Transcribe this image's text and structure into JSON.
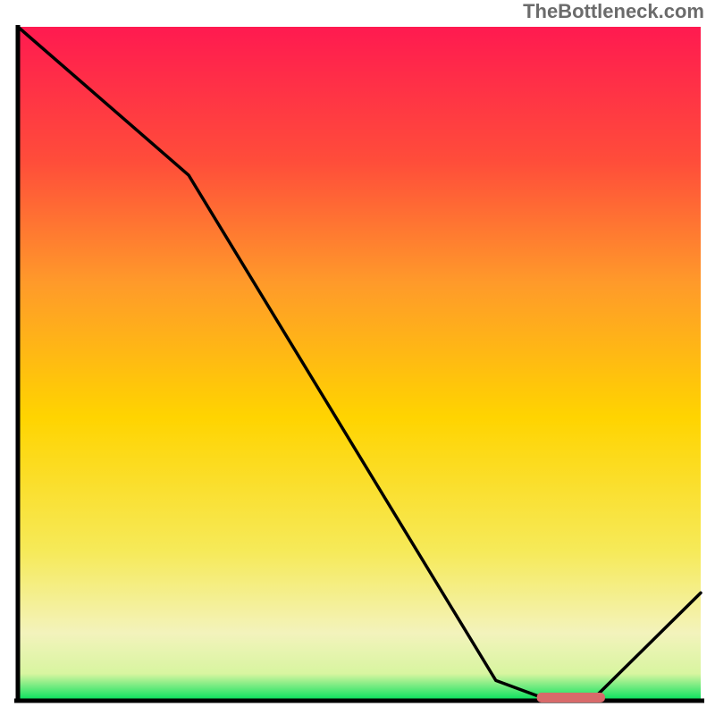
{
  "attribution": "TheBottleneck.com",
  "colors": {
    "axis": "#000000",
    "line": "#000000",
    "marker": "#d86a6a",
    "gradient_top": "#ff1a50",
    "gradient_mid_upper": "#ff7a2a",
    "gradient_mid": "#ffd400",
    "gradient_mid_lower": "#f8f27a",
    "gradient_low": "#f6f6b8",
    "gradient_bottom": "#00e05c"
  },
  "chart_data": {
    "type": "line",
    "title": "",
    "xlabel": "",
    "ylabel": "",
    "xlim": [
      0,
      100
    ],
    "ylim": [
      0,
      100
    ],
    "grid": false,
    "legend": false,
    "x": [
      0,
      25,
      70,
      78,
      84,
      100
    ],
    "values": [
      102,
      78,
      3,
      0,
      0,
      16
    ],
    "marker": {
      "x_start": 76,
      "x_end": 86,
      "y": 0
    },
    "background": "vertical-gradient red→orange→yellow→green"
  }
}
